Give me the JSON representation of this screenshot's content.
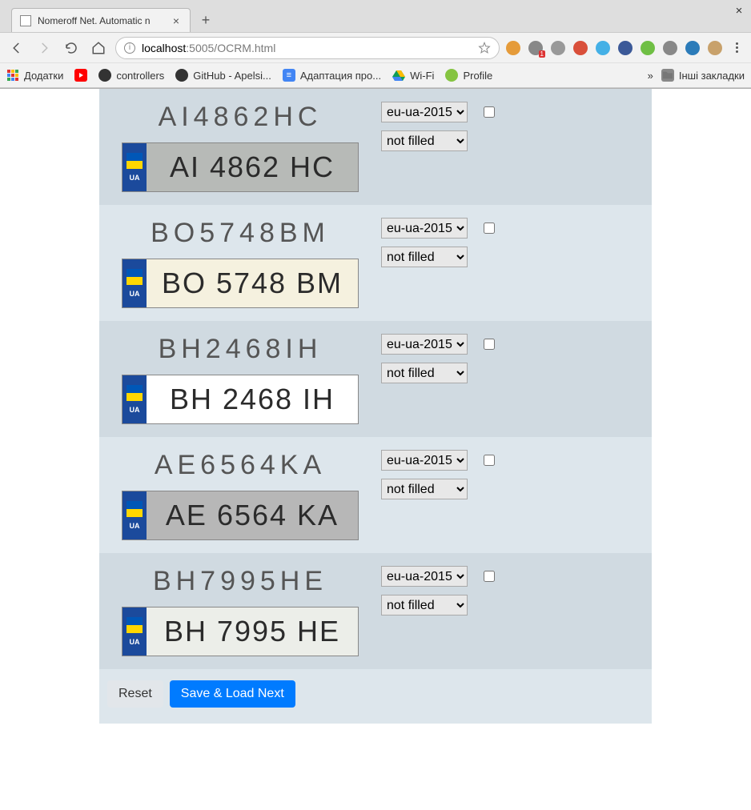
{
  "browser": {
    "tab_title": "Nomeroff Net. Automatic n",
    "url_host": "localhost",
    "url_port_path": ":5005/OCRM.html",
    "window_close": "×",
    "tab_close": "×",
    "new_tab": "+",
    "bookmarks": {
      "apps_label": "Додатки",
      "items": [
        {
          "label": "controllers",
          "color": "#333"
        },
        {
          "label": "GitHub - Apelsi...",
          "color": "#333"
        },
        {
          "label": "Адаптация про...",
          "color": "#4285f4"
        },
        {
          "label": "Wi-Fi",
          "color": "#0f9d58"
        },
        {
          "label": "Profile",
          "color": "#85c441"
        }
      ],
      "overflow_chevron": "»",
      "other_label": "Інші закладки"
    }
  },
  "page": {
    "plates": [
      {
        "text": "AI4862HC",
        "display": "AI 4862 HC",
        "type_option": "eu-ua-2015",
        "state_option": "not filled",
        "checked": false,
        "bg": "#b7bab7",
        "fg": "#2b2b2b",
        "dark_row": true
      },
      {
        "text": "BO5748BM",
        "display": "BO 5748 BM",
        "type_option": "eu-ua-2015",
        "state_option": "not filled",
        "checked": false,
        "bg": "#f5f1df",
        "fg": "#2b2b2b",
        "dark_row": false
      },
      {
        "text": "BH2468IH",
        "display": "BH 2468 IH",
        "type_option": "eu-ua-2015",
        "state_option": "not filled",
        "checked": false,
        "bg": "#ffffff",
        "fg": "#2b2b2b",
        "dark_row": true
      },
      {
        "text": "AE6564KA",
        "display": "AE 6564 KA",
        "type_option": "eu-ua-2015",
        "state_option": "not filled",
        "checked": false,
        "bg": "#b7b7b7",
        "fg": "#2b2b2b",
        "dark_row": false
      },
      {
        "text": "BH7995HE",
        "display": "BH 7995 HE",
        "type_option": "eu-ua-2015",
        "state_option": "not filled",
        "checked": false,
        "bg": "#eceee9",
        "fg": "#2b2b2b",
        "dark_row": true
      }
    ],
    "buttons": {
      "reset": "Reset",
      "save": "Save & Load Next"
    },
    "ua_label": "UA"
  },
  "colors": {
    "accent": "#007bff",
    "panel": "#dde6ec",
    "panel_dark": "#d0dae1"
  }
}
